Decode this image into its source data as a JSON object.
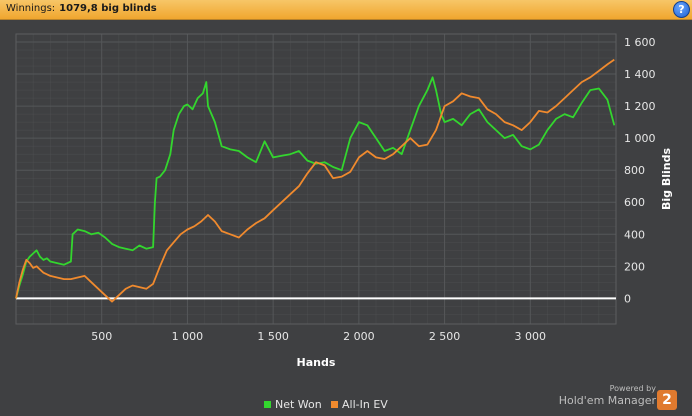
{
  "header": {
    "winnings_label": "Winnings:",
    "winnings_value": "1079,8 big blinds",
    "help_glyph": "?"
  },
  "branding": {
    "powered_by": "Powered by",
    "product": "Hold'em Manager",
    "logo_number": "2"
  },
  "chart_data": {
    "type": "line",
    "xlabel": "Hands",
    "ylabel": "Big Blinds",
    "xlim": [
      0,
      3500
    ],
    "ylim": [
      -160,
      1650
    ],
    "xticks": [
      500,
      1000,
      1500,
      2000,
      2500,
      3000
    ],
    "xtick_labels": [
      "500",
      "1 000",
      "1 500",
      "2 000",
      "2 500",
      "3 000"
    ],
    "yticks": [
      0,
      200,
      400,
      600,
      800,
      1000,
      1200,
      1400,
      1600
    ],
    "ytick_labels": [
      "0",
      "200",
      "400",
      "600",
      "800",
      "1 000",
      "1 200",
      "1 400",
      "1 600"
    ],
    "grid": true,
    "legend_position": "bottom",
    "zero_line": true,
    "colors": {
      "background": "#3f4042",
      "grid": "#555759",
      "zero_line": "#ffffff",
      "axis_text": "#e6e6e6"
    },
    "series": [
      {
        "name": "Net Won",
        "color": "#33d62e",
        "x": [
          0,
          20,
          40,
          60,
          80,
          100,
          120,
          140,
          160,
          180,
          200,
          240,
          280,
          320,
          330,
          360,
          400,
          440,
          480,
          520,
          560,
          600,
          640,
          680,
          720,
          760,
          800,
          810,
          820,
          840,
          870,
          900,
          920,
          950,
          980,
          1000,
          1030,
          1060,
          1090,
          1110,
          1120,
          1160,
          1200,
          1250,
          1300,
          1350,
          1400,
          1450,
          1500,
          1550,
          1600,
          1650,
          1700,
          1750,
          1800,
          1850,
          1900,
          1950,
          2000,
          2050,
          2100,
          2150,
          2200,
          2250,
          2300,
          2350,
          2400,
          2430,
          2450,
          2480,
          2500,
          2550,
          2600,
          2650,
          2700,
          2750,
          2800,
          2850,
          2900,
          2950,
          3000,
          3050,
          3100,
          3150,
          3200,
          3250,
          3300,
          3350,
          3400,
          3450,
          3490
        ],
        "y": [
          0,
          80,
          150,
          230,
          260,
          280,
          300,
          260,
          240,
          250,
          230,
          220,
          210,
          230,
          400,
          430,
          420,
          400,
          410,
          380,
          340,
          320,
          310,
          300,
          330,
          310,
          320,
          600,
          750,
          760,
          800,
          900,
          1050,
          1150,
          1200,
          1210,
          1180,
          1250,
          1280,
          1350,
          1200,
          1100,
          950,
          930,
          920,
          880,
          850,
          980,
          880,
          890,
          900,
          920,
          860,
          840,
          850,
          820,
          800,
          1000,
          1100,
          1080,
          1000,
          920,
          940,
          900,
          1050,
          1200,
          1300,
          1380,
          1300,
          1150,
          1100,
          1120,
          1080,
          1150,
          1180,
          1100,
          1050,
          1000,
          1020,
          950,
          930,
          960,
          1050,
          1120,
          1150,
          1130,
          1220,
          1300,
          1310,
          1240,
          1080
        ]
      },
      {
        "name": "All-In EV",
        "color": "#f08a2e",
        "x": [
          0,
          20,
          40,
          60,
          80,
          100,
          120,
          140,
          160,
          180,
          200,
          240,
          280,
          320,
          360,
          400,
          440,
          480,
          520,
          560,
          600,
          640,
          680,
          720,
          760,
          800,
          840,
          880,
          920,
          960,
          1000,
          1040,
          1080,
          1120,
          1160,
          1200,
          1250,
          1300,
          1350,
          1400,
          1450,
          1500,
          1550,
          1600,
          1650,
          1700,
          1750,
          1800,
          1850,
          1900,
          1950,
          2000,
          2050,
          2100,
          2150,
          2200,
          2250,
          2300,
          2350,
          2400,
          2450,
          2500,
          2550,
          2600,
          2650,
          2700,
          2750,
          2800,
          2850,
          2900,
          2950,
          3000,
          3050,
          3100,
          3150,
          3200,
          3250,
          3300,
          3350,
          3400,
          3450,
          3490
        ],
        "y": [
          0,
          100,
          180,
          240,
          220,
          190,
          200,
          180,
          160,
          150,
          140,
          130,
          120,
          120,
          130,
          140,
          100,
          60,
          20,
          -20,
          20,
          60,
          80,
          70,
          60,
          90,
          200,
          300,
          350,
          400,
          430,
          450,
          480,
          520,
          480,
          420,
          400,
          380,
          430,
          470,
          500,
          550,
          600,
          650,
          700,
          780,
          850,
          830,
          750,
          760,
          790,
          880,
          920,
          880,
          870,
          900,
          950,
          1000,
          950,
          960,
          1050,
          1200,
          1230,
          1280,
          1260,
          1250,
          1180,
          1150,
          1100,
          1080,
          1050,
          1100,
          1170,
          1160,
          1200,
          1250,
          1300,
          1350,
          1380,
          1420,
          1460,
          1490
        ]
      }
    ]
  }
}
